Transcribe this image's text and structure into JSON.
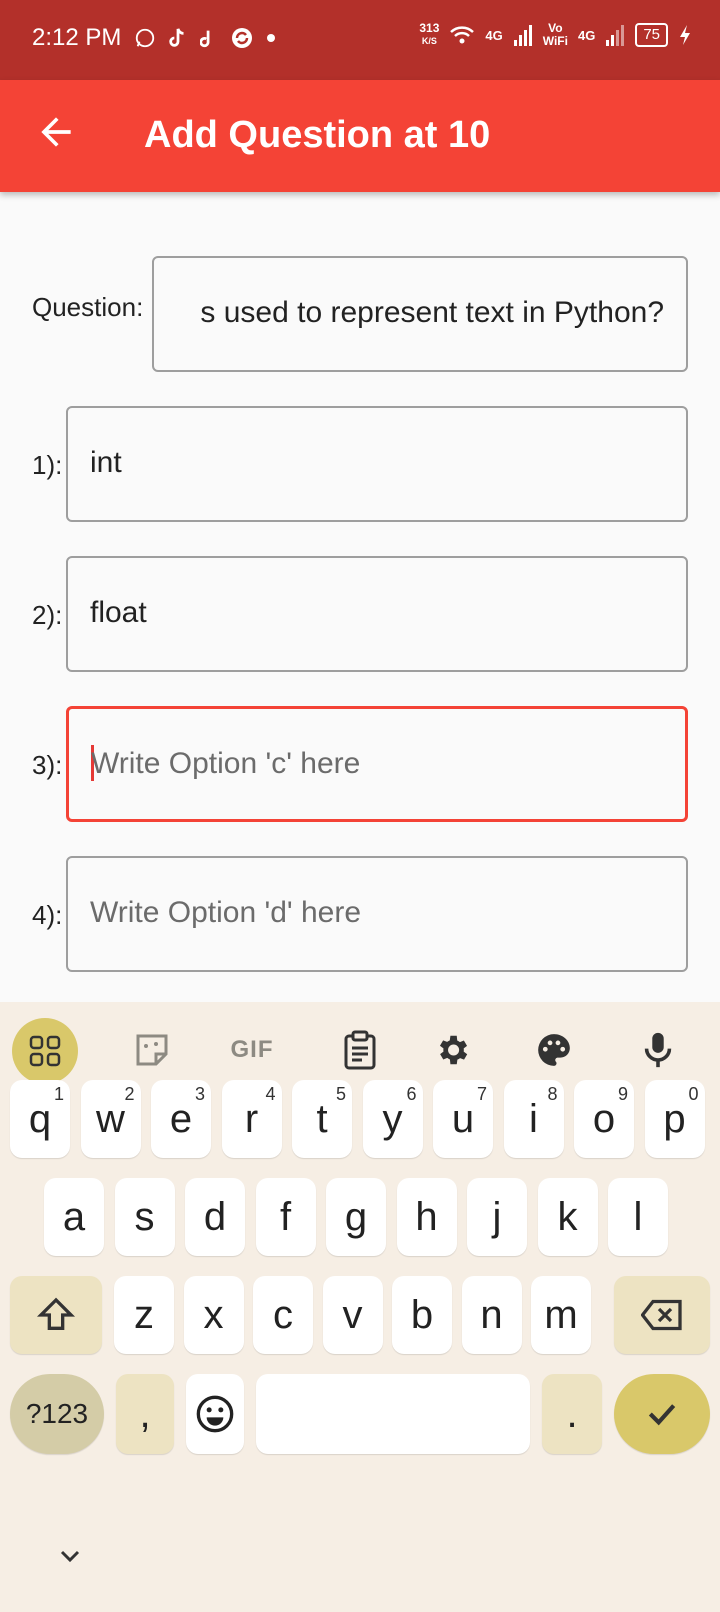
{
  "status": {
    "time": "2:12 PM",
    "speed_top": "313",
    "speed_bottom": "K/S",
    "net1": "4G",
    "vo": "Vo",
    "wifi": "WiFi",
    "net2": "4G",
    "battery": "75"
  },
  "appbar": {
    "title": "Add Question at 10"
  },
  "form": {
    "question_label": "Question:",
    "question_value": "s used to represent text in Python?",
    "options": [
      {
        "label": "1):",
        "value": "int",
        "placeholder": ""
      },
      {
        "label": "2):",
        "value": "float",
        "placeholder": ""
      },
      {
        "label": "3):",
        "value": "",
        "placeholder": "Write Option 'c' here"
      },
      {
        "label": "4):",
        "value": "",
        "placeholder": "Write Option 'd' here"
      }
    ]
  },
  "keyboard": {
    "row1": [
      {
        "k": "q",
        "h": "1"
      },
      {
        "k": "w",
        "h": "2"
      },
      {
        "k": "e",
        "h": "3"
      },
      {
        "k": "r",
        "h": "4"
      },
      {
        "k": "t",
        "h": "5"
      },
      {
        "k": "y",
        "h": "6"
      },
      {
        "k": "u",
        "h": "7"
      },
      {
        "k": "i",
        "h": "8"
      },
      {
        "k": "o",
        "h": "9"
      },
      {
        "k": "p",
        "h": "0"
      }
    ],
    "row2": [
      "a",
      "s",
      "d",
      "f",
      "g",
      "h",
      "j",
      "k",
      "l"
    ],
    "row3": [
      "z",
      "x",
      "c",
      "v",
      "b",
      "n",
      "m"
    ],
    "symbols_label": "?123",
    "comma": ",",
    "period": ".",
    "gif_label": "GIF"
  },
  "colors": {
    "accent": "#f44336",
    "status_bar": "#b3302a",
    "keyboard_bg": "#f6eee4"
  }
}
